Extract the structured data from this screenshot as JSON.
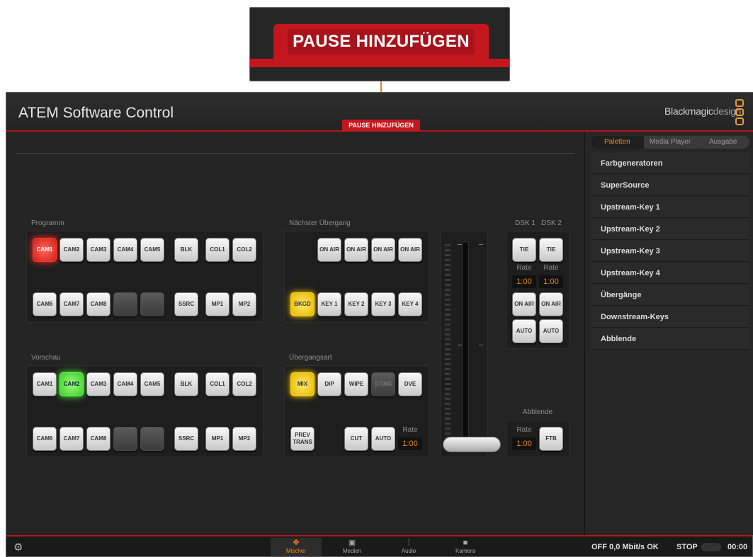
{
  "callout": {
    "label": "PAUSE HINZUFÜGEN"
  },
  "window": {
    "title": "ATEM Software Control",
    "pause_badge": "PAUSE HINZUFÜGEN",
    "logo_bold": "Blackmagic",
    "logo_light": "design"
  },
  "sections": {
    "program": "Programm",
    "preview": "Vorschau",
    "next_transition": "Nächster Übergang",
    "transition_style": "Übergangsart",
    "dsk1": "DSK 1",
    "dsk2": "DSK 2",
    "fade_to_black": "Abblende"
  },
  "program": {
    "row1": [
      "CAM1",
      "CAM2",
      "CAM3",
      "CAM4",
      "CAM5",
      "BLK",
      "COL1",
      "COL2"
    ],
    "row2": [
      "CAM6",
      "CAM7",
      "CAM8",
      "",
      "",
      "SSRC",
      "MP1",
      "MP2"
    ],
    "active": "CAM1"
  },
  "preview": {
    "row1": [
      "CAM1",
      "CAM2",
      "CAM3",
      "CAM4",
      "CAM5",
      "BLK",
      "COL1",
      "COL2"
    ],
    "row2": [
      "CAM6",
      "CAM7",
      "CAM8",
      "",
      "",
      "SSRC",
      "MP1",
      "MP2"
    ],
    "active": "CAM2"
  },
  "next_transition": {
    "on_air": [
      "ON AIR",
      "ON AIR",
      "ON AIR",
      "ON AIR"
    ],
    "keys": [
      "BKGD",
      "KEY 1",
      "KEY 2",
      "KEY 3",
      "KEY 4"
    ]
  },
  "transition_style": {
    "styles": [
      "MIX",
      "DIP",
      "WIPE",
      "STING",
      "DVE"
    ],
    "prev_trans": "PREV TRANS",
    "cut": "CUT",
    "auto": "AUTO",
    "rate_label": "Rate",
    "rate_value": "1:00"
  },
  "dsk": {
    "tie": "TIE",
    "rate_label": "Rate",
    "rate1": "1:00",
    "rate2": "1:00",
    "on_air": "ON AIR",
    "auto": "AUTO"
  },
  "ftb": {
    "rate_label": "Rate",
    "rate_value": "1:00",
    "button": "FTB"
  },
  "sidebar": {
    "tabs": [
      "Paletten",
      "Media Player",
      "Ausgabe"
    ],
    "items": [
      "Farbgeneratoren",
      "SuperSource",
      "Upstream-Key 1",
      "Upstream-Key 2",
      "Upstream-Key 3",
      "Upstream-Key 4",
      "Übergänge",
      "Downstream-Keys",
      "Abblende"
    ]
  },
  "bottom": {
    "nav": [
      "Mischer",
      "Medien",
      "Audio",
      "Kamera"
    ],
    "status": "OFF 0,0 Mbit/s OK",
    "stop": "STOP",
    "time": "00:00"
  }
}
